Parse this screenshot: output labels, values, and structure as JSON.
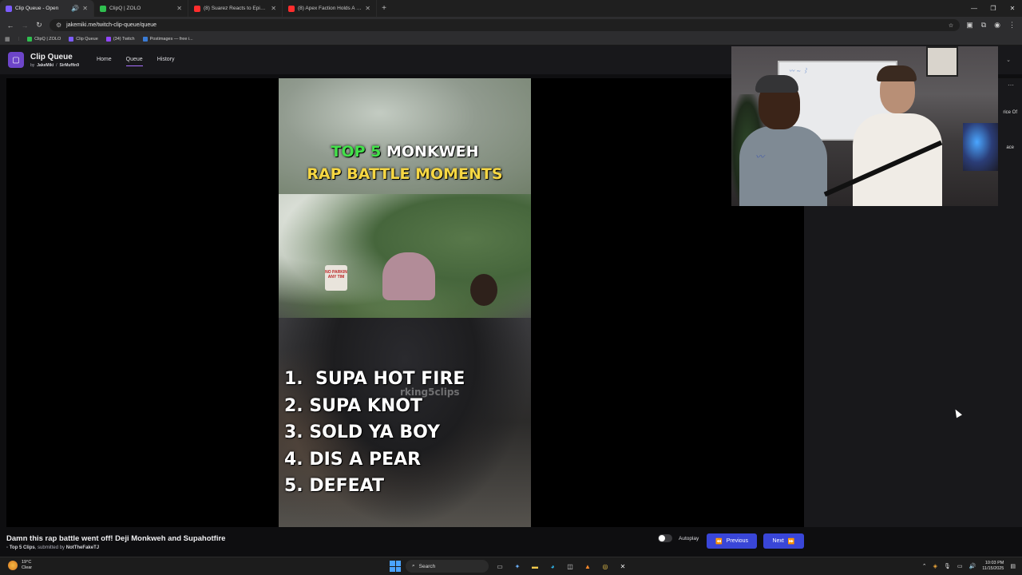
{
  "browser": {
    "tabs": [
      {
        "title": "Clip Queue - Open",
        "color": "#7c5cff",
        "active": true
      },
      {
        "title": "ClipQ | ZOLO",
        "color": "#2fbf4f",
        "active": false
      },
      {
        "title": "(8) Suarez Reacts to Epic 2 Gam",
        "color": "#ff2d2d",
        "active": false
      },
      {
        "title": "(8) Apex Faction Holds A Meeti",
        "color": "#ff2d2d",
        "active": false
      }
    ],
    "url": "jakemiki.me/twitch-clip-queue/queue",
    "bookmarks": [
      {
        "label": "ClipQ | ZOLO",
        "color": "#2fbf4f"
      },
      {
        "label": "Clip Queue",
        "color": "#7c5cff"
      },
      {
        "label": "(34) Twitch",
        "color": "#9146ff"
      },
      {
        "label": "Postimages — free i...",
        "color": "#3a7bd5"
      }
    ]
  },
  "app": {
    "title": "Clip Queue",
    "by": "by",
    "author": "JakeMiki",
    "separator": "/",
    "contributor": "SirMuffin9",
    "nav": [
      "Home",
      "Queue",
      "History"
    ],
    "active_nav": "Queue"
  },
  "video": {
    "title_line1_green": "TOP 5",
    "title_line1_white": "MONKWEH",
    "title_line2": "RAP BATTLE MOMENTS",
    "sign_text": "NO PARKIN ANY TIM",
    "watermark": "rking5clips",
    "list": [
      "1.  SUPA HOT FIRE",
      "2. SUPA KNOT",
      "3. SOLD YA BOY",
      "4. DIS A PEAR",
      "5. DEFEAT"
    ]
  },
  "sidebar": {
    "text1": "rice Of",
    "text2": "ace"
  },
  "clip": {
    "title": "Damn this rap battle went off! Deji Monkweh and Supahotfire",
    "channel": "Top 5 Clips",
    "submitted_prefix": ", submitted by",
    "submitter": "NotTheFakeTJ"
  },
  "controls": {
    "autoplay_label": "Autoplay",
    "autoplay_on": false,
    "previous_label": "Previous",
    "next_label": "Next"
  },
  "taskbar": {
    "temp": "19°C",
    "weather": "Clear",
    "search": "Search",
    "time": "10:03 PM",
    "date": "11/15/2025"
  }
}
